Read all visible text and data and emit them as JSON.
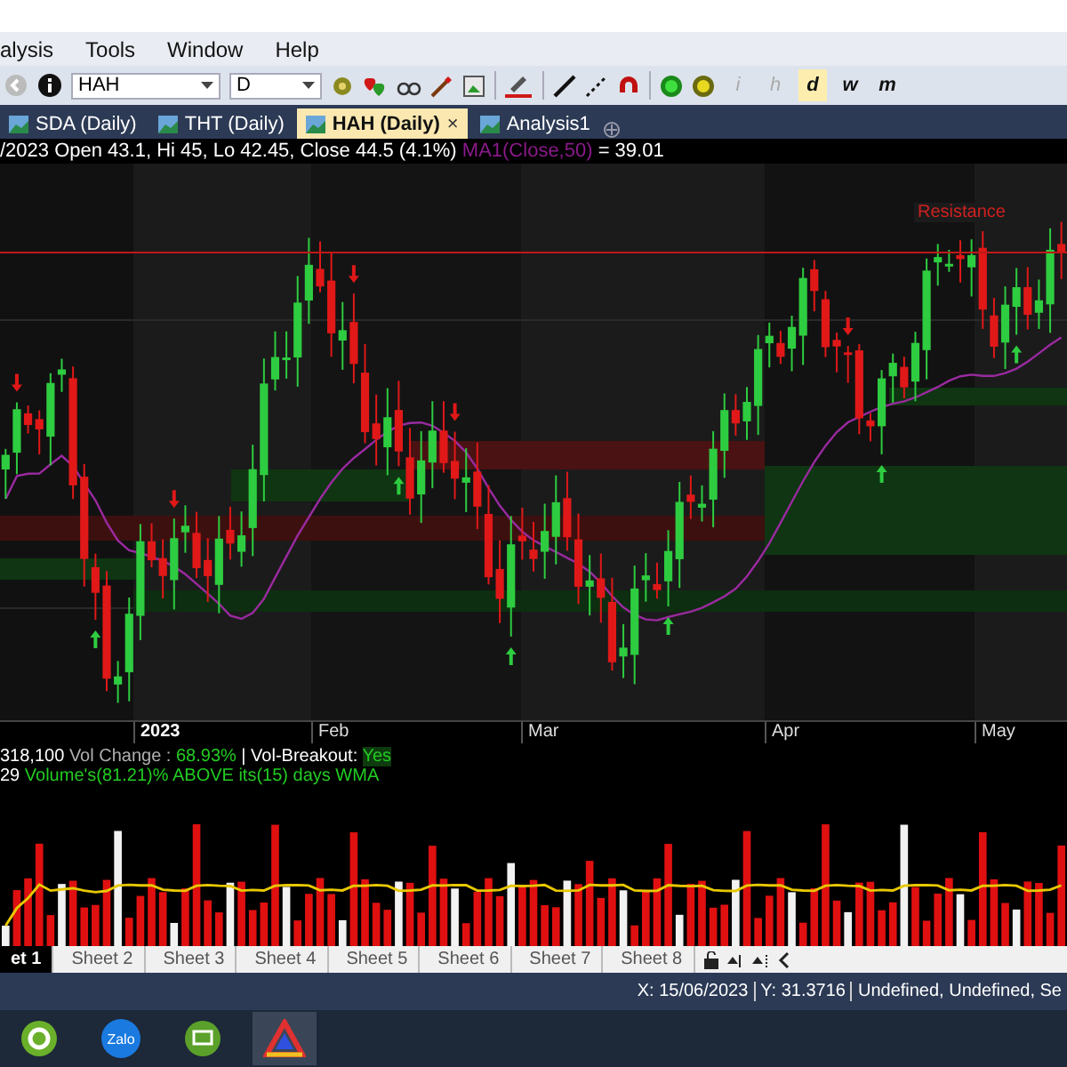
{
  "menu": [
    "alysis",
    "Tools",
    "Window",
    "Help"
  ],
  "toolbar": {
    "symbol": "HAH",
    "interval": "D",
    "interval_buttons": [
      {
        "label": "i",
        "selected": false,
        "disabled": true
      },
      {
        "label": "h",
        "selected": false,
        "disabled": true
      },
      {
        "label": "d",
        "selected": true,
        "disabled": false
      },
      {
        "label": "w",
        "selected": false,
        "disabled": false
      },
      {
        "label": "m",
        "selected": false,
        "disabled": false
      }
    ]
  },
  "tabs": [
    {
      "label": "SDA (Daily)",
      "selected": false
    },
    {
      "label": "THT (Daily)",
      "selected": false
    },
    {
      "label": "HAH (Daily)",
      "selected": true,
      "close": "×"
    },
    {
      "label": "Analysis1",
      "selected": false
    }
  ],
  "chart": {
    "header": [
      {
        "text": "/2023 Open 43.1, Hi 45, Lo 42.45, Close 44.5 (4.1%) ",
        "kind": "plain"
      },
      {
        "text": "MA1(Close,50)",
        "kind": "indicator"
      },
      {
        "text": " = 39.01",
        "kind": "plain"
      }
    ],
    "annotation": "Resistance",
    "x_labels": [
      "2023",
      "Feb",
      "Mar",
      "Apr",
      "May"
    ]
  },
  "volume": {
    "lines": [
      [
        {
          "text": "318,100 ",
          "kind": "plain"
        },
        {
          "text": "Vol Change : ",
          "kind": "muted"
        },
        {
          "text": "68.93%",
          "kind": "positive"
        },
        {
          "text": " | Vol-Breakout: ",
          "kind": "plain"
        },
        {
          "text": "Yes",
          "kind": "flag"
        }
      ],
      [
        {
          "text": "29 ",
          "kind": "plain"
        },
        {
          "text": "Volume's(81.21)% ABOVE its(15) days WMA",
          "kind": "positive"
        }
      ]
    ]
  },
  "sheets": [
    {
      "label": "et 1",
      "selected": true
    },
    {
      "label": "Sheet 2",
      "selected": false
    },
    {
      "label": "Sheet 3",
      "selected": false
    },
    {
      "label": "Sheet 4",
      "selected": false
    },
    {
      "label": "Sheet 5",
      "selected": false
    },
    {
      "label": "Sheet 6",
      "selected": false
    },
    {
      "label": "Sheet 7",
      "selected": false
    },
    {
      "label": "Sheet 8",
      "selected": false
    }
  ],
  "status_bar": [
    "X: 15/06/2023",
    "Y: 31.3716",
    "Undefined, Undefined, Se"
  ],
  "taskbar": [
    {
      "kind": "ring",
      "selected": false
    },
    {
      "kind": "chat",
      "label": "Zalo",
      "selected": false
    },
    {
      "kind": "screen",
      "selected": false
    },
    {
      "kind": "triangle",
      "selected": true
    }
  ]
}
